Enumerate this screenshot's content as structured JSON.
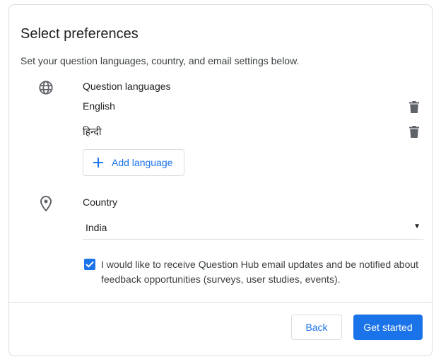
{
  "header": {
    "title": "Select preferences",
    "subtitle": "Set your question languages, country, and email settings below."
  },
  "languages": {
    "section_label": "Question languages",
    "icon": "globe-icon",
    "items": [
      {
        "label": "English",
        "action_icon": "trash-icon"
      },
      {
        "label": "हिन्दी",
        "action_icon": "trash-icon"
      }
    ],
    "add_label": "Add language"
  },
  "country": {
    "section_label": "Country",
    "icon": "location-pin-icon",
    "selected": "India"
  },
  "email_opt_in": {
    "checked": true,
    "text": "I would like to receive Question Hub email updates and be notified about feedback opportunities (surveys, user studies, events)."
  },
  "footer": {
    "back_label": "Back",
    "start_label": "Get started"
  },
  "colors": {
    "accent": "#1a73e8",
    "border": "#dadce0",
    "icon": "#5f6368",
    "text": "#202124"
  }
}
